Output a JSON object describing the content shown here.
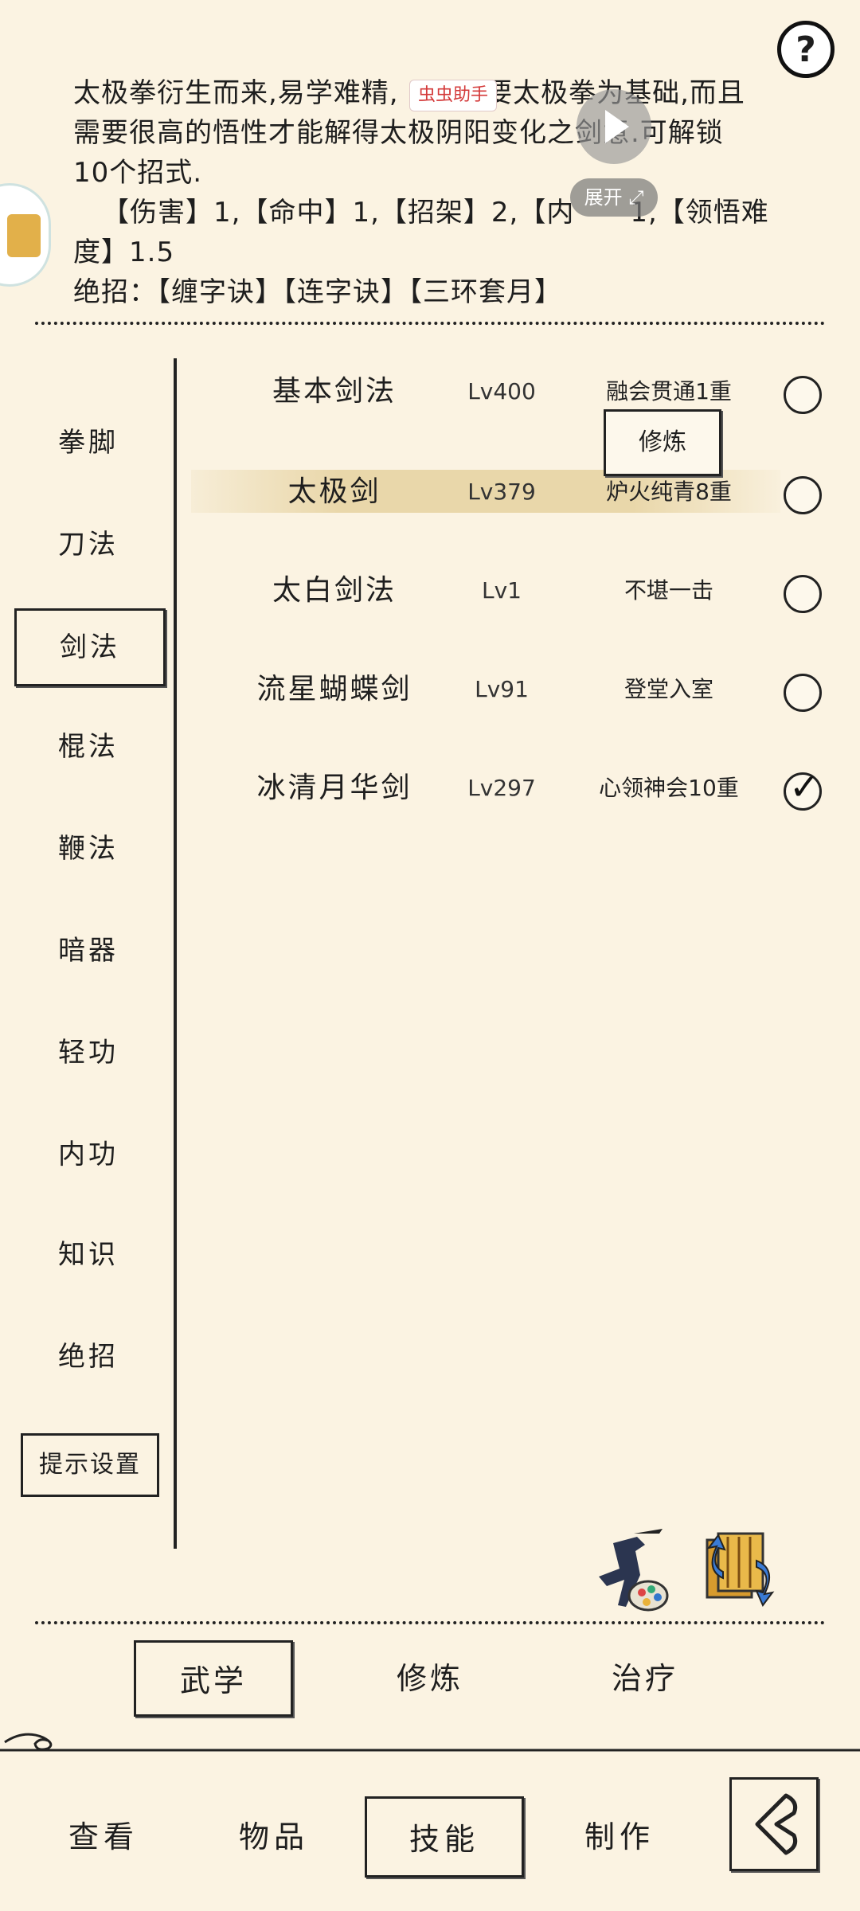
{
  "description": {
    "line1": "太极拳衍生而来,易学难精,",
    "line1b": ";要太极拳为基础,而且",
    "line2": "需要很高的悟性才能解得太极阴阳变化之剑意.可解锁",
    "line3": "10个招式.",
    "stats_a": "【伤害】1,【命中】1,【招架】2,【内",
    "stats_b": "1,【领悟难",
    "stats_c": "度】1.5",
    "ultimate_label": "绝招：",
    "ultimates": "【缠字诀】【连字诀】【三环套月】"
  },
  "overlay": {
    "helper_tag": "虫虫助手",
    "expand_label": "展开"
  },
  "help_label": "?",
  "categories": [
    {
      "label": "拳脚"
    },
    {
      "label": "刀法"
    },
    {
      "label": "剑法"
    },
    {
      "label": "棍法"
    },
    {
      "label": "鞭法"
    },
    {
      "label": "暗器"
    },
    {
      "label": "轻功"
    },
    {
      "label": "内功"
    },
    {
      "label": "知识"
    },
    {
      "label": "绝招"
    }
  ],
  "selected_category": "剑法",
  "hint_settings_label": "提示设置",
  "skills": [
    {
      "name": "基本剑法",
      "level": "Lv400",
      "rank": "融会贯通1重",
      "checked": false
    },
    {
      "name": "太极剑",
      "level": "Lv379",
      "rank": "炉火纯青8重",
      "checked": false
    },
    {
      "name": "太白剑法",
      "level": "Lv1",
      "rank": "不堪一击",
      "checked": false
    },
    {
      "name": "流星蝴蝶剑",
      "level": "Lv91",
      "rank": "登堂入室",
      "checked": false
    },
    {
      "name": "冰清月华剑",
      "level": "Lv297",
      "rank": "心领神会10重",
      "checked": true
    }
  ],
  "train_popup_label": "修炼",
  "subtabs": [
    {
      "label": "武学"
    },
    {
      "label": "修炼"
    },
    {
      "label": "治疗"
    }
  ],
  "nav": [
    {
      "label": "查看"
    },
    {
      "label": "物品"
    },
    {
      "label": "技能"
    },
    {
      "label": "制作"
    }
  ],
  "colors": {
    "background": "#fbf3e2",
    "ink": "#1e1e1e",
    "highlight": "#e6d2a0",
    "tag_red": "#d43a3a"
  }
}
